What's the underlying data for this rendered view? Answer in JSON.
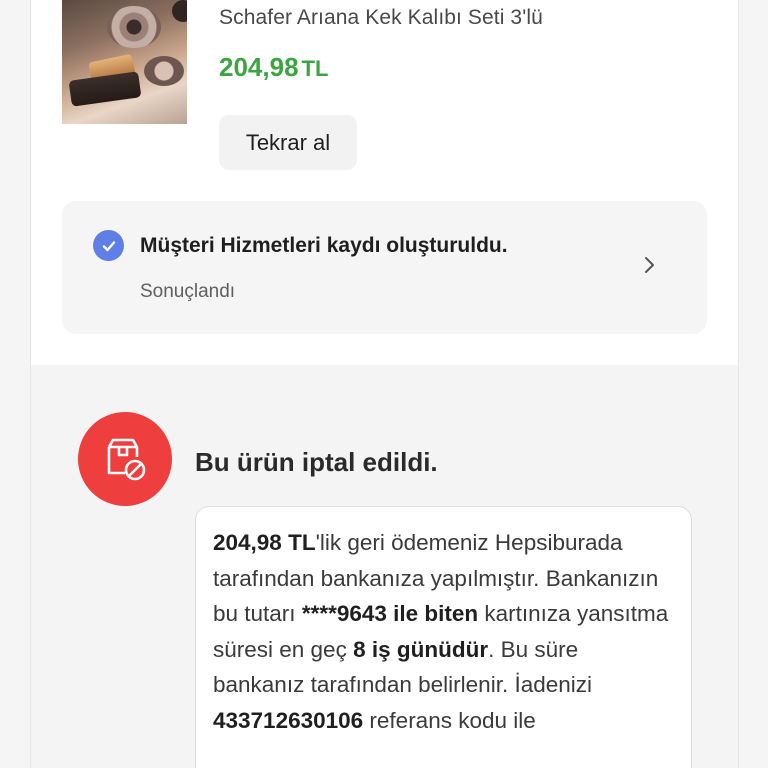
{
  "product": {
    "title": "Schafer Arıana Kek Kalıbı Seti 3'lü",
    "price": "204,98",
    "currency": "TL",
    "rebuy_label": "Tekrar al",
    "image_icon": "product-photo"
  },
  "service_ticket": {
    "icon": "check-circle-icon",
    "title": "Müşteri Hizmetleri kaydı oluşturuldu.",
    "status": "Sonuçlandı",
    "chevron_icon": "chevron-right-icon"
  },
  "cancellation": {
    "icon": "box-cancel-icon",
    "title": "Bu ürün iptal edildi.",
    "refund_amount": "204,98 TL",
    "text_1": "'lik geri ödemeniz Hepsiburada tarafından bankanıza yapılmıştır. Bankanızın bu tutarı ",
    "card": "****9643 ile biten",
    "text_2": " kartınıza yansıtma süresi en geç ",
    "days": "8 iş günüdür",
    "text_3": ". Bu süre bankanız tarafından belirlenir. İadenizi ",
    "reference": "433712630106",
    "text_4": " referans kodu ile"
  },
  "colors": {
    "price_green": "#3ba53f",
    "check_blue": "#5f7fe6",
    "cancel_red": "#ee3e3e"
  }
}
